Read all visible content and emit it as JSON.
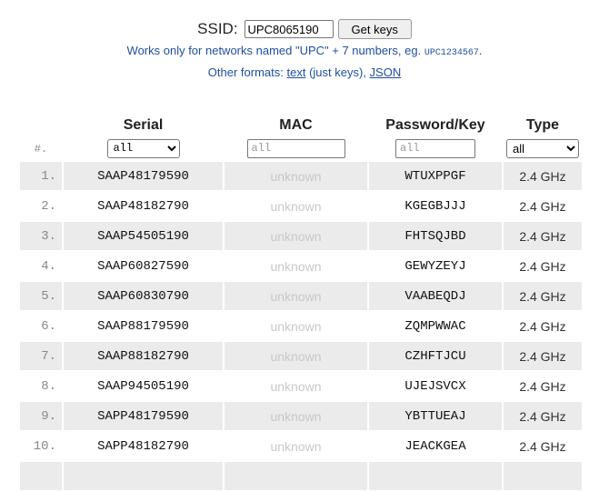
{
  "ssid": {
    "label": "SSID:",
    "value": "UPC8065190",
    "button": "Get keys"
  },
  "note": {
    "text": "Works only for networks named \"UPC\" + 7 numbers, eg.",
    "example": "UPC1234567",
    "end": "."
  },
  "formats": {
    "prefix": "Other formats:",
    "text_link": "text",
    "middle": "(just keys),",
    "json_link": "JSON"
  },
  "table": {
    "headers": {
      "serial": "Serial",
      "mac": "MAC",
      "password": "Password/Key",
      "type": "Type"
    },
    "filters": {
      "hash": "#.",
      "serial_selected": "all",
      "mac_placeholder": "all",
      "password_placeholder": "all",
      "type_selected": "all"
    },
    "rows": [
      {
        "num": "1.",
        "serial": "SAAP48179590",
        "mac": "unknown",
        "password": "WTUXPPGF",
        "type": "2.4 GHz"
      },
      {
        "num": "2.",
        "serial": "SAAP48182790",
        "mac": "unknown",
        "password": "KGEGBJJJ",
        "type": "2.4 GHz"
      },
      {
        "num": "3.",
        "serial": "SAAP54505190",
        "mac": "unknown",
        "password": "FHTSQJBD",
        "type": "2.4 GHz"
      },
      {
        "num": "4.",
        "serial": "SAAP60827590",
        "mac": "unknown",
        "password": "GEWYZEYJ",
        "type": "2.4 GHz"
      },
      {
        "num": "5.",
        "serial": "SAAP60830790",
        "mac": "unknown",
        "password": "VAABEQDJ",
        "type": "2.4 GHz"
      },
      {
        "num": "6.",
        "serial": "SAAP88179590",
        "mac": "unknown",
        "password": "ZQMPWWAC",
        "type": "2.4 GHz"
      },
      {
        "num": "7.",
        "serial": "SAAP88182790",
        "mac": "unknown",
        "password": "CZHFTJCU",
        "type": "2.4 GHz"
      },
      {
        "num": "8.",
        "serial": "SAAP94505190",
        "mac": "unknown",
        "password": "UJEJSVCX",
        "type": "2.4 GHz"
      },
      {
        "num": "9.",
        "serial": "SAPP48179590",
        "mac": "unknown",
        "password": "YBTTUEAJ",
        "type": "2.4 GHz"
      },
      {
        "num": "10.",
        "serial": "SAPP48182790",
        "mac": "unknown",
        "password": "JEACKGEA",
        "type": "2.4 GHz"
      }
    ]
  }
}
